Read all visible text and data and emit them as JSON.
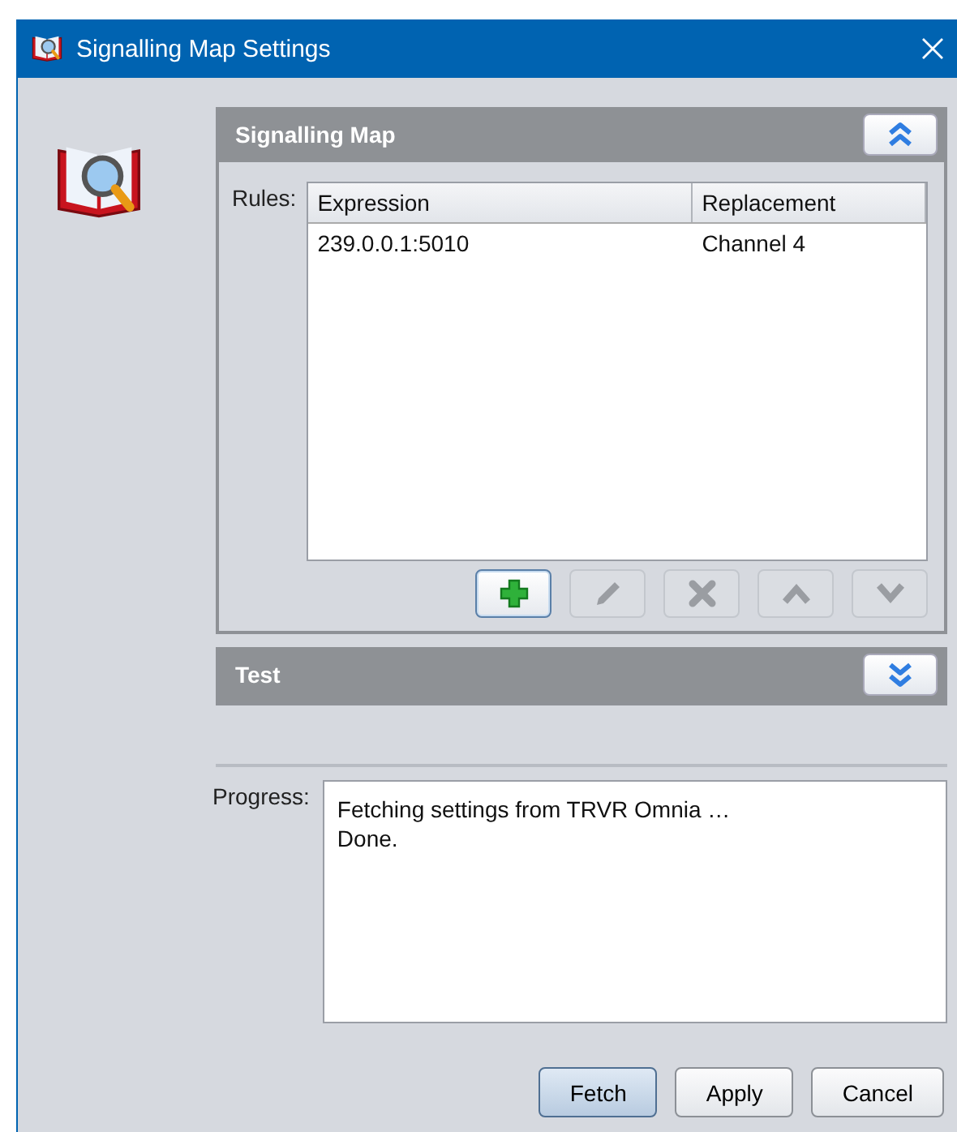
{
  "window": {
    "title": "Signalling Map Settings"
  },
  "sections": [
    {
      "title": "Signalling Map",
      "expanded": true,
      "rules_label": "Rules:",
      "columns": [
        "Expression",
        "Replacement"
      ],
      "rows": [
        [
          "239.0.0.1:5010",
          "Channel 4"
        ]
      ],
      "tools": [
        {
          "kind": "add",
          "disabled": false,
          "focused": true
        },
        {
          "kind": "edit",
          "disabled": true,
          "focused": false
        },
        {
          "kind": "delete",
          "disabled": true,
          "focused": false
        },
        {
          "kind": "up",
          "disabled": true,
          "focused": false
        },
        {
          "kind": "down",
          "disabled": true,
          "focused": false
        }
      ]
    },
    {
      "title": "Test",
      "expanded": false
    }
  ],
  "progress": {
    "label": "Progress:",
    "lines": [
      "Fetching settings from TRVR Omnia …",
      "Done."
    ]
  },
  "buttons": [
    {
      "label": "Fetch",
      "default": true
    },
    {
      "label": "Apply",
      "default": false
    },
    {
      "label": "Cancel",
      "default": false
    }
  ]
}
